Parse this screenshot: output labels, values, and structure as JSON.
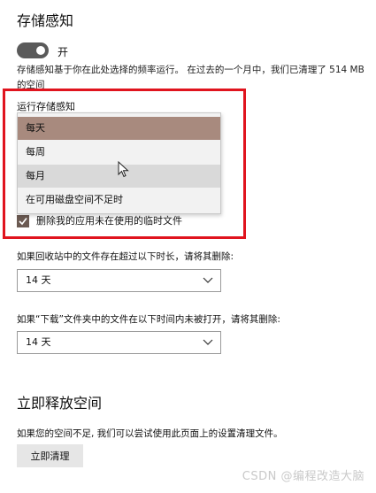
{
  "storage_sense": {
    "title": "存储感知",
    "toggle_label": "开",
    "description": "存储感知基于你在此处选择的频率运行。 在过去的一个月中，我们已清理了 514 MB 的空间"
  },
  "run_frequency": {
    "label": "运行存储感知",
    "options": [
      "每天",
      "每周",
      "每月",
      "在可用磁盘空间不足时"
    ],
    "selected": "每天"
  },
  "temp_files": {
    "label": "删除我的应用未在使用的临时文件",
    "checked": true
  },
  "recycle_bin": {
    "label": "如果回收站中的文件存在超过以下时长，请将其删除:",
    "value": "14 天"
  },
  "downloads": {
    "label": "如果“下载”文件夹中的文件在以下时间内未被打开，请将其删除:",
    "value": "14 天"
  },
  "free_space": {
    "title": "立即释放空间",
    "description": "如果您的空间不足, 我们可以尝试使用此页面上的设置清理文件。",
    "button_label": "立即清理"
  },
  "watermark": "CSDN @编程改造大脑",
  "colors": {
    "highlight": "#e0141e",
    "selected_option": "#a88a7e",
    "hover_option": "#d9d9d9",
    "toggle_on": "#5a5a5a"
  }
}
